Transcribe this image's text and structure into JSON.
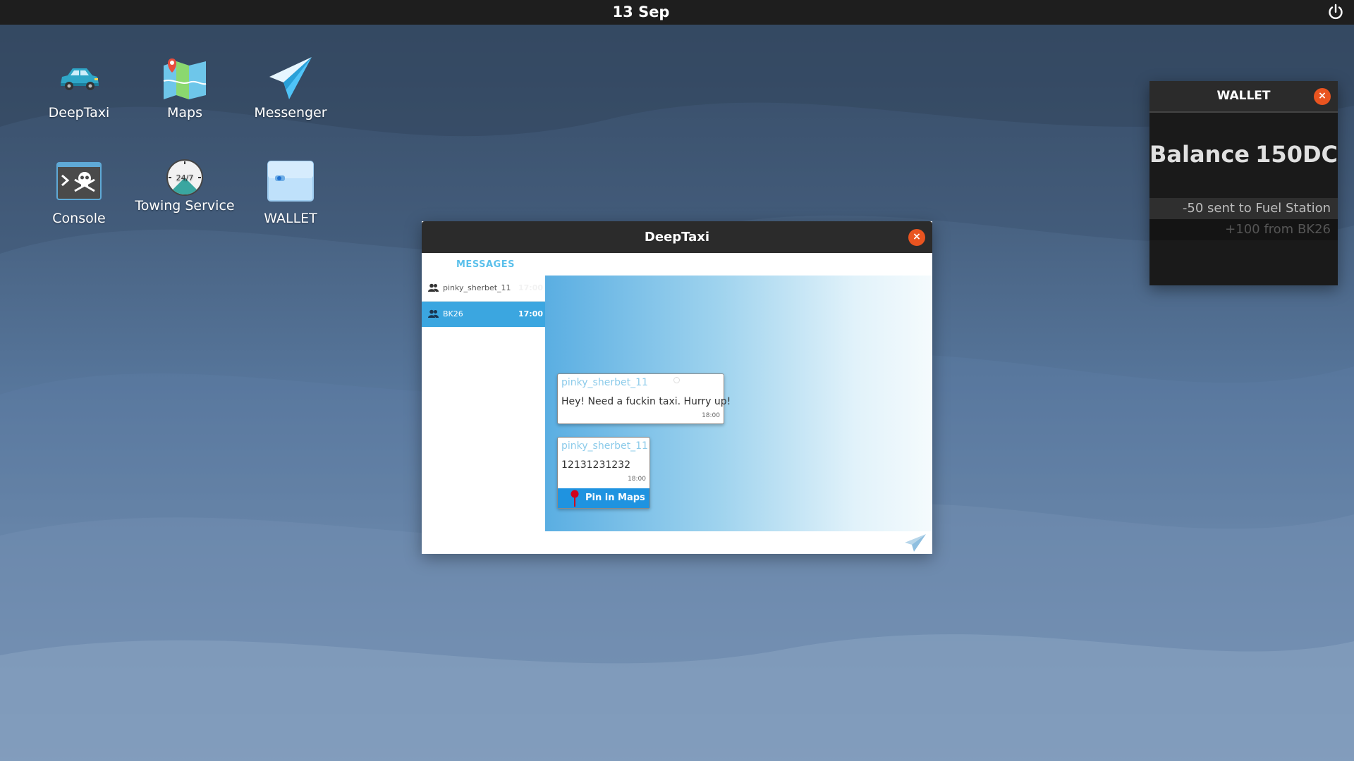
{
  "topbar": {
    "date": "13 Sep"
  },
  "desktop": {
    "icons": [
      {
        "label": "DeepTaxi",
        "icon": "car-icon"
      },
      {
        "label": "Maps",
        "icon": "map-icon"
      },
      {
        "label": "Messenger",
        "icon": "paper-plane-icon"
      },
      {
        "label": "Console",
        "icon": "skull-terminal-icon"
      },
      {
        "label": "Towing Service",
        "icon": "clock-24-7-icon"
      },
      {
        "label": "WALLET",
        "icon": "wallet-icon"
      }
    ]
  },
  "window": {
    "title": "DeepTaxi",
    "close_label": "×",
    "tab": "MESSAGES",
    "conversations": [
      {
        "name": "pinky_sherbet_11",
        "time": "17:00",
        "active": false
      },
      {
        "name": "BK26",
        "time": "17:00",
        "active": true
      }
    ],
    "messages": [
      {
        "sender": "pinky_sherbet_11",
        "text": "Hey! Need a fuckin taxi. Hurry up!",
        "time": "18:00"
      },
      {
        "sender": "pinky_sherbet_11",
        "text": "12131231232",
        "time": "18:00",
        "action": "Pin in Maps"
      }
    ]
  },
  "wallet": {
    "title": "WALLET",
    "close_label": "×",
    "balance_label": "Balance",
    "balance_value": "150DC",
    "transactions": [
      "-50 sent to Fuel Station",
      "+100 from BK26"
    ]
  },
  "colors": {
    "accent": "#3ba6e0",
    "close": "#e95420",
    "titlebar": "#2b2b2b"
  }
}
